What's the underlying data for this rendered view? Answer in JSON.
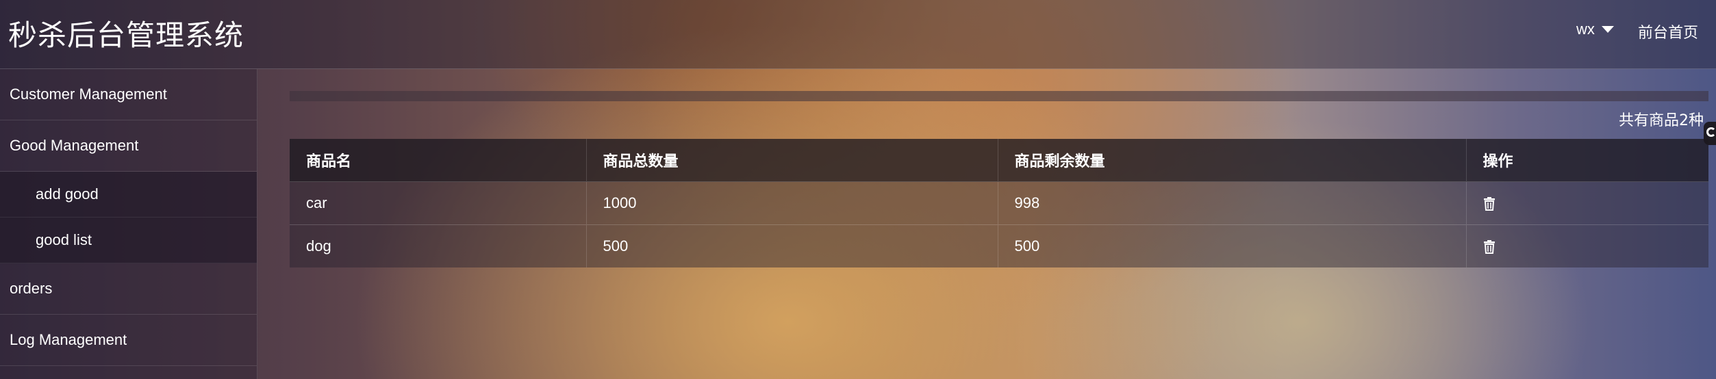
{
  "header": {
    "title": "秒杀后台管理系统",
    "user": "wx",
    "home_link": "前台首页"
  },
  "sidebar": {
    "items": [
      {
        "label": "Customer Management"
      },
      {
        "label": "Good Management"
      },
      {
        "label": "add good",
        "sub": true
      },
      {
        "label": "good list",
        "sub": true
      },
      {
        "label": "orders"
      },
      {
        "label": "Log Management"
      }
    ]
  },
  "main": {
    "count_text": "共有商品2种",
    "table": {
      "columns": [
        "商品名",
        "商品总数量",
        "商品剩余数量",
        "操作"
      ],
      "rows": [
        {
          "name": "car",
          "total": "1000",
          "remaining": "998",
          "action_icon": "trash-icon"
        },
        {
          "name": "dog",
          "total": "500",
          "remaining": "500",
          "action_icon": "trash-icon"
        }
      ]
    }
  },
  "colors": {
    "text": "#ffffff",
    "header_bg": "#1c1820",
    "sidebar_sub_bg": "#1e1624"
  }
}
